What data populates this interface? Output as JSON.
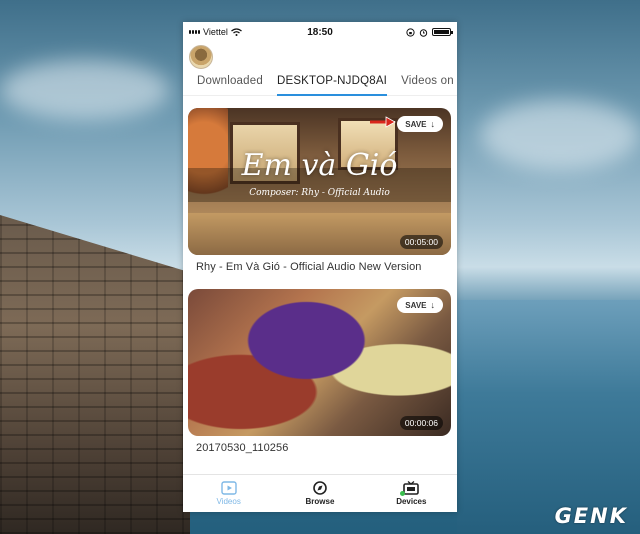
{
  "status_bar": {
    "carrier": "Viettel",
    "time": "18:50"
  },
  "tabs": [
    {
      "label": "Downloaded"
    },
    {
      "label": "DESKTOP-NJDQ8AI"
    },
    {
      "label": "Videos on iPhone"
    }
  ],
  "videos": [
    {
      "thumb_title": "Em và Gió",
      "thumb_subtitle": "Composer: Rhy - Official Audio",
      "save_label": "SAVE",
      "duration": "00:05:00",
      "title": "Rhy - Em Và Gió - Official Audio New Version"
    },
    {
      "save_label": "SAVE",
      "duration": "00:00:06",
      "title": "20170530_110256"
    }
  ],
  "tabbar": [
    {
      "label": "Videos",
      "icon": "play-square-icon",
      "active": true
    },
    {
      "label": "Browse",
      "icon": "compass-icon",
      "active": false
    },
    {
      "label": "Devices",
      "icon": "tv-icon",
      "active": false
    }
  ],
  "watermark": "GENK",
  "colors": {
    "accent": "#2a8fdd",
    "active_tab": "#7fb8e6",
    "save_arrow": "#d9261c",
    "online_dot": "#3bbf4f"
  }
}
